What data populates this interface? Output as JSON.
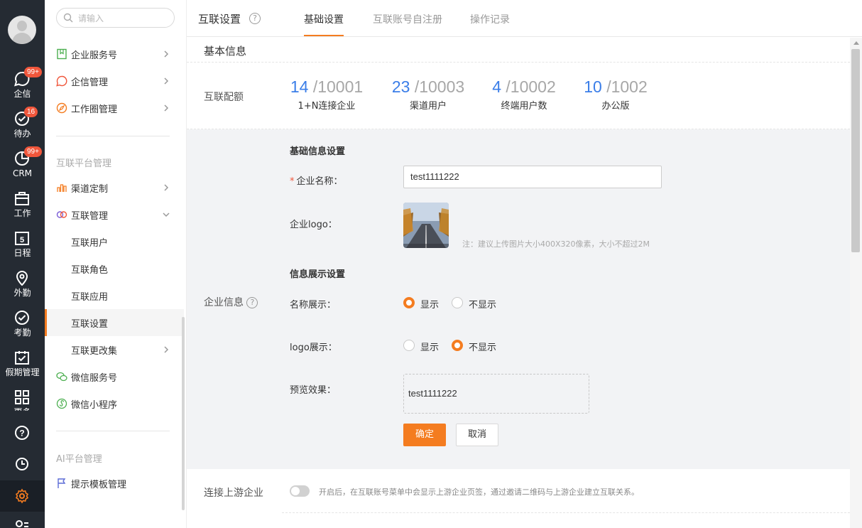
{
  "rail": {
    "items": [
      {
        "label": "企信",
        "badge": "99+",
        "icon": "chat-bubble-icon"
      },
      {
        "label": "待办",
        "badge": "16",
        "icon": "check-circle-icon"
      },
      {
        "label": "CRM",
        "badge": "99+",
        "icon": "pie-chart-icon"
      },
      {
        "label": "工作",
        "badge": "",
        "icon": "briefcase-icon"
      },
      {
        "label": "日程",
        "badge": "",
        "icon": "calendar-icon",
        "date": "5"
      },
      {
        "label": "外勤",
        "badge": "",
        "icon": "location-pin-icon"
      },
      {
        "label": "考勤",
        "badge": "",
        "icon": "check-badge-icon"
      },
      {
        "label": "假期管理",
        "badge": "",
        "icon": "calendar-check-icon"
      },
      {
        "label": "更多",
        "badge": "",
        "icon": "grid-icon"
      }
    ]
  },
  "subnav": {
    "search_placeholder": "请输入",
    "group1": [
      {
        "label": "企业服务号"
      },
      {
        "label": "企信管理"
      },
      {
        "label": "工作圈管理"
      }
    ],
    "section2_title": "互联平台管理",
    "group2": [
      {
        "label": "渠道定制"
      },
      {
        "label": "互联管理"
      },
      {
        "label": "互联用户"
      },
      {
        "label": "互联角色"
      },
      {
        "label": "互联应用"
      },
      {
        "label": "互联设置"
      },
      {
        "label": "互联更改集"
      },
      {
        "label": "微信服务号"
      },
      {
        "label": "微信小程序"
      }
    ],
    "section3_title": "AI平台管理",
    "group3": [
      {
        "label": "提示模板管理"
      }
    ]
  },
  "header": {
    "title": "互联设置",
    "help": "?",
    "tabs": [
      {
        "label": "基础设置",
        "active": true
      },
      {
        "label": "互联账号自注册",
        "active": false
      },
      {
        "label": "操作记录",
        "active": false
      }
    ]
  },
  "main": {
    "section_title": "基本信息",
    "quota_label": "互联配额",
    "quotas": [
      {
        "used": "14",
        "total": "/10001",
        "label": "1+N连接企业"
      },
      {
        "used": "23",
        "total": "/10003",
        "label": "渠道用户"
      },
      {
        "used": "4",
        "total": "/10002",
        "label": "终端用户数"
      },
      {
        "used": "10",
        "total": "/1002",
        "label": "办公版"
      }
    ],
    "company_info_label": "企业信息",
    "basic_settings_title": "基础信息设置",
    "company_name_label": "企业名称：",
    "required_mark": "*",
    "company_name_value": "test1111222",
    "logo_label": "企业logo：",
    "logo_hint": "注：建议上传图片大小400X320像素，大小不超过2M",
    "display_settings_title": "信息展示设置",
    "name_display_label": "名称展示：",
    "logo_display_label": "logo展示：",
    "show_label": "显示",
    "hide_label": "不显示",
    "name_display_selected": "显示",
    "logo_display_selected": "不显示",
    "preview_label": "预览效果：",
    "preview_value": "test1111222",
    "confirm_label": "确定",
    "cancel_label": "取消",
    "upstream_label": "连接上游企业",
    "upstream_hint": "开启后，在互联账号菜单中会显示上游企业页签，通过邀请二维码与上游企业建立互联关系。",
    "upstream_enabled": false
  },
  "colors": {
    "accent": "#f47c20",
    "rail_bg": "#252b33",
    "quota_blue": "#3b7ee8",
    "badge": "#f0563b"
  }
}
